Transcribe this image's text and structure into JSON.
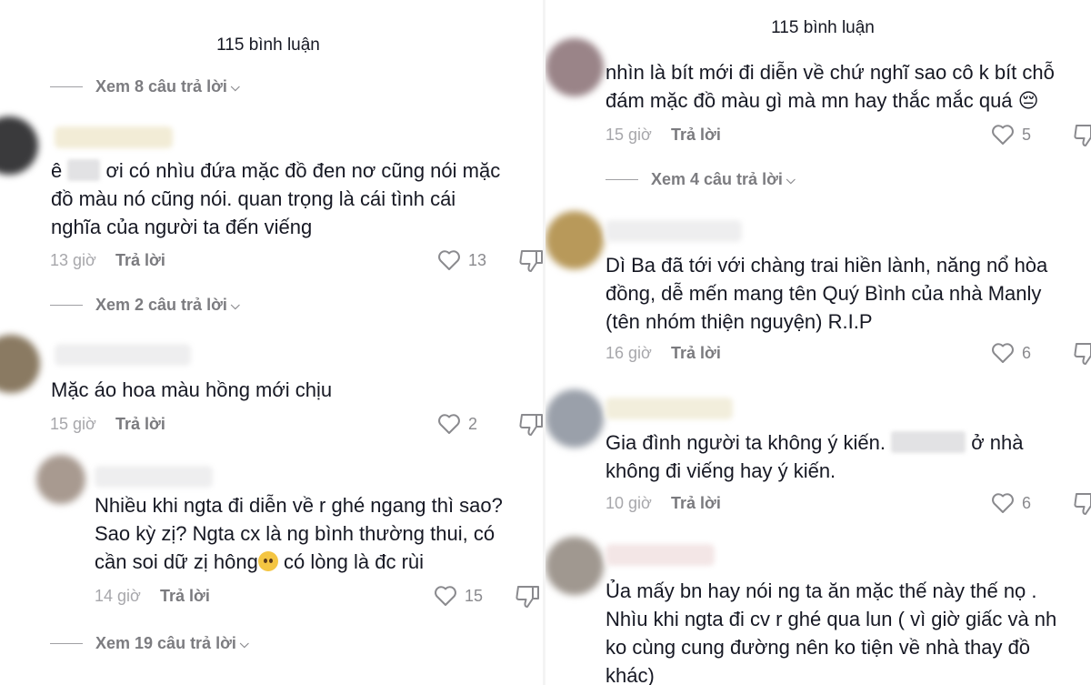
{
  "left": {
    "header": "115 bình luận",
    "view_more_1": "Xem 8 câu trả lời",
    "comments": [
      {
        "line1_pre": "ê",
        "line1_post": "ơi có nhìu đứa mặc đồ đen nơ cũng nói mặc",
        "line2": "đồ màu nó cũng nói. quan trọng là cái tình cái",
        "line3": "nghĩa của người ta đến viếng",
        "time": "13 giờ",
        "reply": "Trả lời",
        "likes": "13"
      },
      {
        "line1": "Mặc áo hoa màu hồng mới chịu",
        "time": "15 giờ",
        "reply": "Trả lời",
        "likes": "2"
      },
      {
        "line1": "Nhiều khi ngta đi diễn về r ghé ngang thì sao?",
        "line2": "Sao kỳ zị? Ngta cx là ng bình thường thui, có",
        "line3_pre": "cần soi dữ zị hông",
        "line3_post": "có lòng là đc rùi",
        "time": "14 giờ",
        "reply": "Trả lời",
        "likes": "15"
      }
    ],
    "view_more_2": "Xem 2 câu trả lời",
    "view_more_3": "Xem 19 câu trả lời"
  },
  "right": {
    "header": "115 bình luận",
    "view_more_1": "Xem 4 câu trả lời",
    "comments": [
      {
        "line1": "nhìn là bít mới đi diễn về chứ nghĩ sao cô k bít chỗ",
        "line2": "đám mặc đồ màu gì mà mn hay thắc mắc quá 😔",
        "time": "15 giờ",
        "reply": "Trả lời",
        "likes": "5"
      },
      {
        "line1": "Dì Ba đã tới với chàng trai hiền lành, năng nổ hòa",
        "line2": "đồng, dễ mến mang tên Quý Bình của nhà Manly",
        "line3": "(tên nhóm thiện nguyện) R.I.P",
        "time": "16 giờ",
        "reply": "Trả lời",
        "likes": "6"
      },
      {
        "line1_pre": "Gia đình người ta không ý kiến.",
        "line1_post": "ở nhà",
        "line2": "không đi viếng hay ý kiến.",
        "time": "10 giờ",
        "reply": "Trả lời",
        "likes": "6"
      },
      {
        "line1": "Ủa mấy bn hay nói ng ta ăn mặc thế này thế nọ .",
        "line2": "Nhìu khi ngta đi cv r ghé qua lun ( vì giờ giấc và nh",
        "line3": "ko cùng cung đường nên ko tiện về nhà thay đồ",
        "line4": "khác)"
      }
    ]
  }
}
